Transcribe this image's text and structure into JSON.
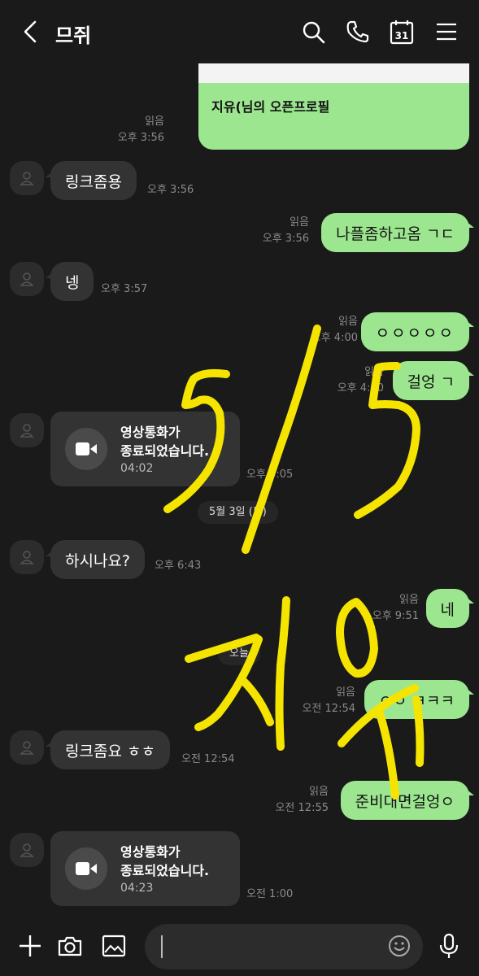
{
  "header": {
    "title": "므쥐",
    "icons": [
      "back-icon",
      "search-icon",
      "phone-icon",
      "calendar-icon",
      "menu-icon"
    ],
    "calendar_day": "31"
  },
  "messages": {
    "profile_card": {
      "text": "지유(님의 오픈프로필",
      "read": "읽음",
      "time": "오후 3:56"
    },
    "m1": {
      "text": "링크좀용",
      "time": "오후 3:56"
    },
    "m2": {
      "text": "나플좀하고옴 ㄱㄷ",
      "read": "읽음",
      "time": "오후 3:56"
    },
    "m3": {
      "text": "넹",
      "time": "오후 3:57"
    },
    "m4": {
      "text": "ㅇㅇㅇㅇㅇ",
      "read": "읽음",
      "time": "오후 4:00"
    },
    "m5": {
      "text": "걸엉 ㄱ",
      "read": "읽음",
      "time": "오후 4:00"
    },
    "m6": {
      "line1": "영상통화가",
      "line2": "종료되었습니다.",
      "duration": "04:02",
      "time": "오후 4:05"
    },
    "date1": "5월 3일 (토)",
    "m7": {
      "text": "하시나요?",
      "time": "오후 6:43"
    },
    "m8": {
      "text": "네",
      "read": "읽음",
      "time": "오후 9:51"
    },
    "date2": "오늘",
    "m9": {
      "text": "ㅇㅇ ㅋㅋㅋ",
      "read": "읽음",
      "time": "오전 12:54"
    },
    "m10": {
      "text": "링크좀요 ㅎㅎ",
      "time": "오전 12:54"
    },
    "m11": {
      "text": "준비대면걸엉ㅇ",
      "read": "읽음",
      "time": "오전 12:55"
    },
    "m12": {
      "line1": "영상통화가",
      "line2": "종료되었습니다.",
      "duration": "04:23",
      "time": "오전 1:00"
    }
  },
  "overlay": {
    "description_color": "#f5e400"
  },
  "composer": {
    "icons": [
      "plus-icon",
      "camera-icon",
      "gallery-icon",
      "emoji-icon",
      "mic-icon"
    ],
    "value": ""
  },
  "colors": {
    "out_bubble": "#9de690",
    "in_bubble": "#333333",
    "background": "#1a1a1a",
    "scribble": "#f5e400"
  }
}
